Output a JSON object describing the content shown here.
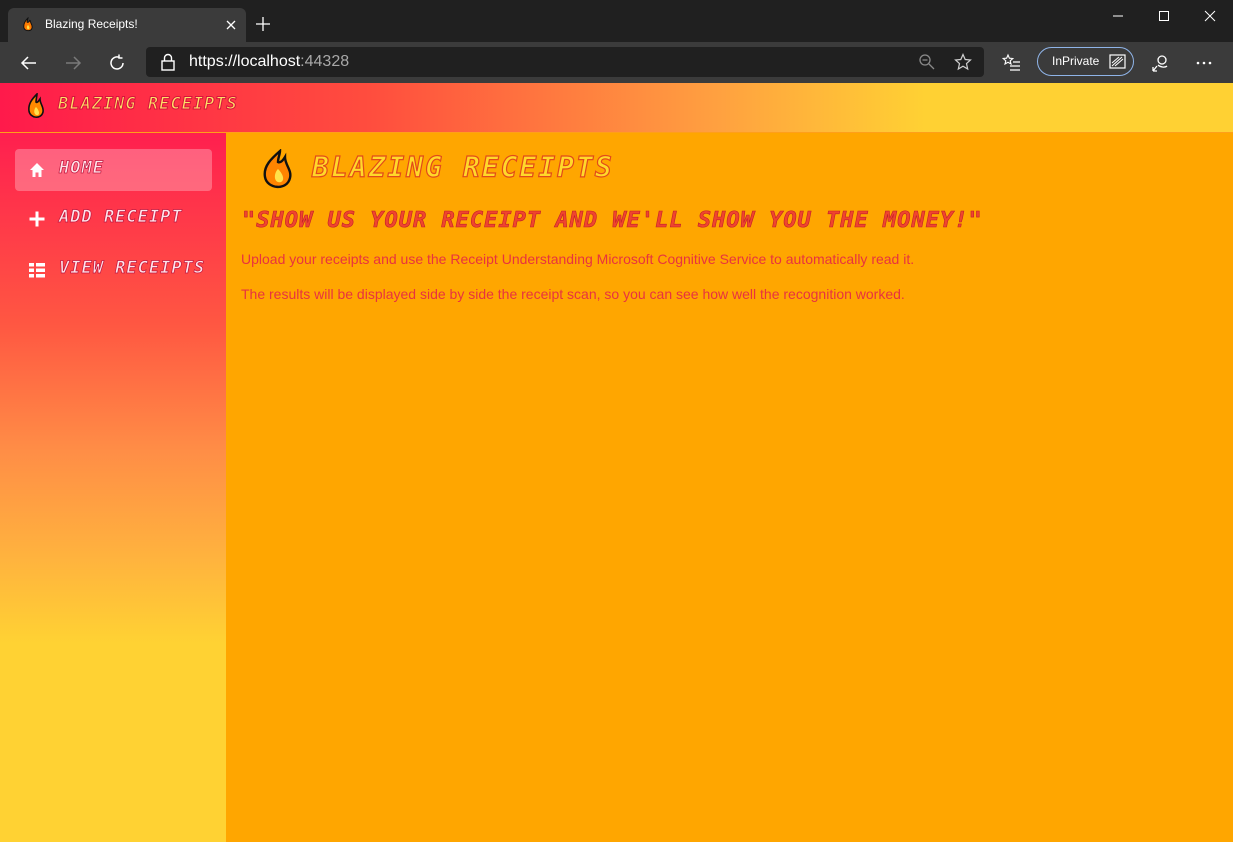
{
  "browser": {
    "tab_title": "Blazing Receipts!",
    "url_main": "https://localhost",
    "url_port": ":44328",
    "inprivate_label": "InPrivate"
  },
  "app": {
    "brand": "Blazing Receipts",
    "colors": {
      "main_bg": "#ffa600",
      "accent_red": "#ff1a4b",
      "accent_yellow": "#ffd133",
      "text_red": "#e8333f"
    }
  },
  "sidebar": {
    "items": [
      {
        "label": "Home",
        "icon": "home-icon",
        "active": true
      },
      {
        "label": "Add Receipt",
        "icon": "plus-icon",
        "active": false
      },
      {
        "label": "View Receipts",
        "icon": "list-icon",
        "active": false
      }
    ]
  },
  "main": {
    "title": "Blazing Receipts",
    "tagline": "\"Show us your receipt and we'll show you the money!\"",
    "paragraphs": [
      "Upload your receipts and use the Receipt Understanding Microsoft Cognitive Service to automatically read it.",
      "The results will be displayed side by side the receipt scan, so you can see how well the recognition worked."
    ]
  }
}
